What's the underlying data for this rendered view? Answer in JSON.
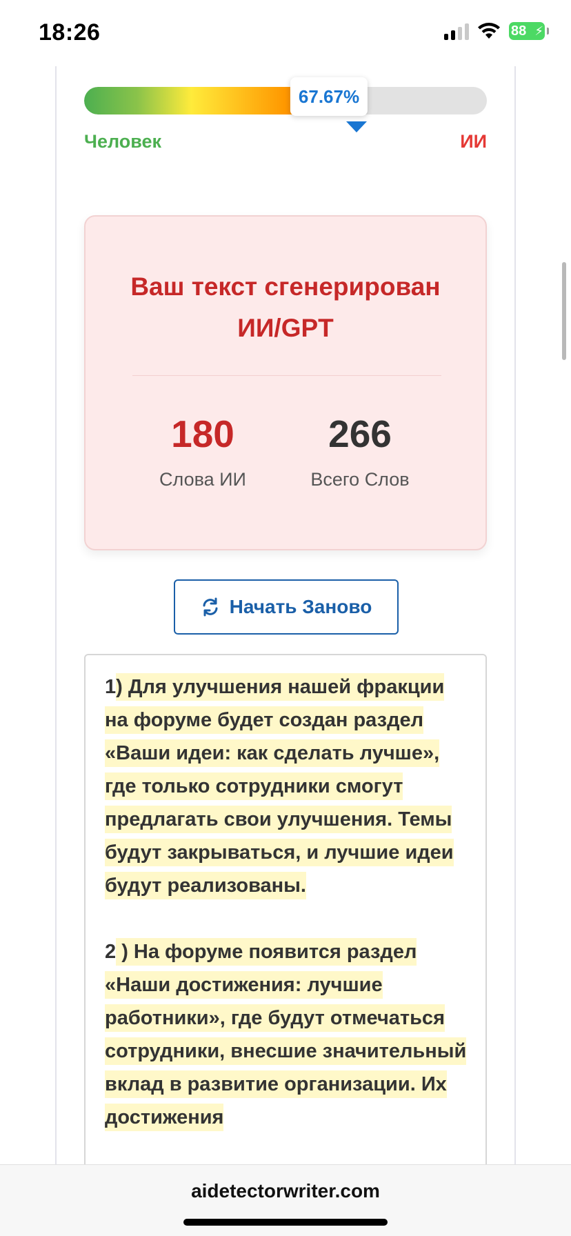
{
  "status_bar": {
    "time": "18:26",
    "battery": "88"
  },
  "gauge": {
    "percent_label": "67.67%",
    "fill_fraction": 0.6767,
    "label_human": "Человек",
    "label_ai": "ИИ"
  },
  "result": {
    "title": "Ваш текст сгенерирован ИИ/GPT",
    "ai_words_value": "180",
    "ai_words_label": "Слова ИИ",
    "total_words_value": "266",
    "total_words_label": "Всего Слов"
  },
  "restart_button": {
    "label": "Начать Заново",
    "icon": "refresh-icon"
  },
  "text_box": {
    "paragraphs": [
      {
        "number": "1",
        "highlighted": ") Для улучшения нашей фракции на форуме будет создан раздел «Ваши идеи: как сделать лучше», где только сотрудники смогут предлагать свои улучшения.  Темы будут закрываться, и лучшие идеи будут реализованы."
      },
      {
        "number": "2",
        "highlighted": " ) На форуме появится раздел «Наши достижения: лучшие работники», где будут отмечаться сотрудники, внесшие значительный вклад в развитие организации.  Их достижения"
      }
    ]
  },
  "url_bar": {
    "url": "aidetectorwriter.com"
  },
  "colors": {
    "human": "#4caf50",
    "ai": "#e53935",
    "accent": "#1976d2",
    "card_bg": "#fdeaea",
    "highlight": "#fff8c9"
  }
}
